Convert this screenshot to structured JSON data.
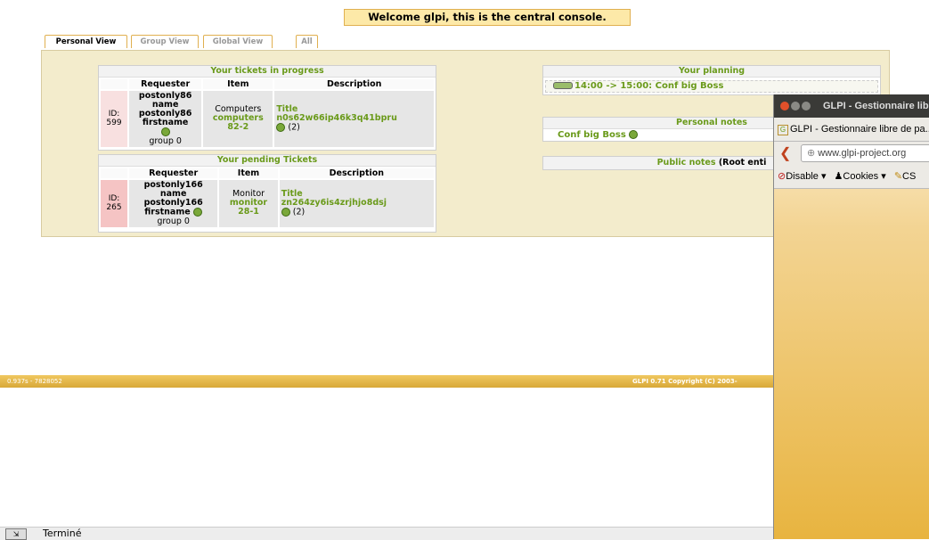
{
  "welcome": "Welcome glpi, this is the central console.",
  "tabs": [
    {
      "label": "Personal View"
    },
    {
      "label": "Group View"
    },
    {
      "label": "Global View"
    },
    {
      "label": "All"
    }
  ],
  "in_progress": {
    "title": "Your tickets in progress",
    "headers": [
      "Requester",
      "Item",
      "Description"
    ],
    "ticket": {
      "id_label": "ID:",
      "id": "599",
      "requester_lines": [
        "postonly86",
        "name",
        "postonly86",
        "firstname"
      ],
      "group": "group 0",
      "item_type": "Computers",
      "item_name": "computers",
      "item_num": "82-2",
      "desc_title": "Title",
      "desc_text": "n0s62w66ip46k3q41bpru",
      "followups": "(2)"
    }
  },
  "pending": {
    "title": "Your pending Tickets",
    "headers": [
      "Requester",
      "Item",
      "Description"
    ],
    "ticket": {
      "id_label": "ID:",
      "id": "265",
      "requester_lines": [
        "postonly166",
        "name",
        "postonly166",
        "firstname"
      ],
      "group": "group 0",
      "item_type": "Monitor",
      "item_name": "monitor",
      "item_num": "28-1",
      "desc_title": "Title",
      "desc_text": "zn264zy6is4zrjhjo8dsj",
      "followups": "(2)"
    }
  },
  "planning": {
    "title": "Your planning",
    "entry": "14:00 -> 15:00: Conf big Boss"
  },
  "personal_notes": {
    "title": "Personal notes",
    "entry": "Conf big Boss"
  },
  "public_notes": {
    "title": "Public notes",
    "suffix": "(Root enti"
  },
  "footer": {
    "left": "0.937s - 7828052",
    "right": "GLPI 0.71 Copyright (C) 2003-"
  },
  "status": "Terminé",
  "browser": {
    "window_title": "GLPI - Gestionnaire lib",
    "tab_title": "GLPI - Gestionnaire libre de pa...",
    "url": "www.glpi-project.org",
    "tools": [
      "Disable ▾",
      "Cookies ▾",
      "CS"
    ]
  }
}
